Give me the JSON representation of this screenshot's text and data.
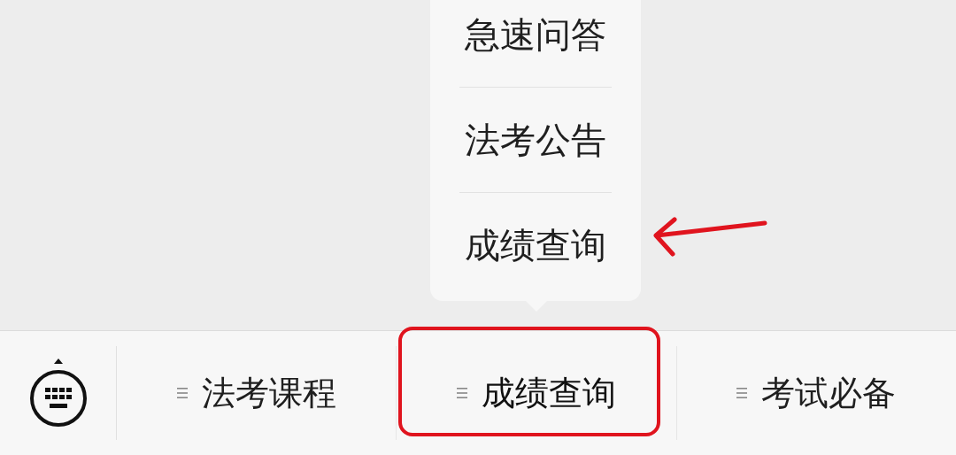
{
  "submenu": {
    "items": [
      {
        "label": "急速问答"
      },
      {
        "label": "法考公告"
      },
      {
        "label": "成绩查询"
      }
    ]
  },
  "menu_bar": {
    "items": [
      {
        "label": "法考课程",
        "open": false
      },
      {
        "label": "成绩查询",
        "open": true
      },
      {
        "label": "考试必备",
        "open": false
      }
    ]
  }
}
